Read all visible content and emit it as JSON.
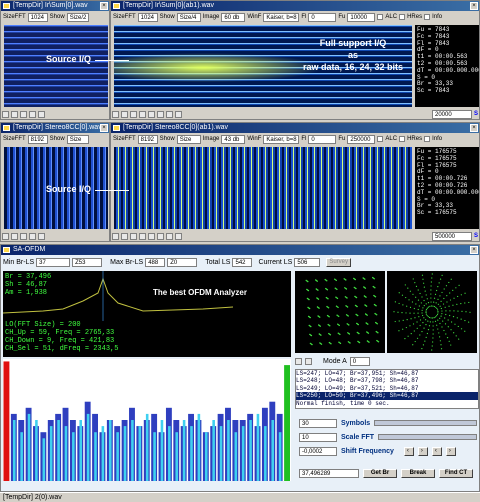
{
  "win1": {
    "title": "[TempDir] Ir\\Sum[0].wav",
    "size_label": "SizeFFT",
    "size_val": "1024",
    "show_label": "Show",
    "show_val": "Size/2"
  },
  "win2": {
    "title": "[TempDir] Ir\\Sum[0](ab1).wav",
    "size_label": "SizeFFT",
    "size_val": "1024",
    "show_label": "Show",
    "show_val": "Size/4",
    "image_label": "Image",
    "image_val": "60 db",
    "win_label": "WinF",
    "win_val": "Kaiser, b=8",
    "fl_label": "Fl",
    "fl_val": "0",
    "fu_label": "Fu",
    "fu_val": "10000",
    "alc": "ALC",
    "hres": "HRes",
    "info": "Info",
    "overlay": "Full support I/Q\nas\nraw data, 16, 24, 32 bits",
    "stats": [
      "Fu = 7843",
      "Fc = 7843",
      "Fl = 7843",
      "dF = 0",
      "t1 = 00:00.563",
      "t2 = 00:00.563",
      "dT = 00:00.000.000",
      "S = 0",
      "Br = 33,33",
      "Sc = 7843"
    ],
    "bottom_val": "20000",
    "bottom_S": "S"
  },
  "win3": {
    "title": "[TempDir] Stereo8CC[0].wav",
    "size_label": "SizeFFT",
    "size_val": "8192",
    "show_label": "Show",
    "show_val": "Size"
  },
  "win4": {
    "title": "[TempDir] Stereo8CC[0](ab1).wav",
    "size_label": "SizeFFT",
    "size_val": "8192",
    "show_label": "Show",
    "show_val": "Size",
    "image_label": "Image",
    "image_val": "43 db",
    "win_label": "WinF",
    "win_val": "Kaiser, b=8",
    "fl_label": "Fl",
    "fl_val": "0",
    "fu_label": "Fu",
    "fu_val": "250000",
    "alc": "ALC",
    "hres": "HRes",
    "info": "Info",
    "stats": [
      "Fu = 176575",
      "Fc = 176575",
      "Fl = 176575",
      "dF = 0",
      "t1 = 00:00.726",
      "t2 = 00:00.726",
      "dT = 00:00.000.000",
      "S = 0",
      "Br = 33,33",
      "Sc = 176575"
    ],
    "bottom_val": "500000",
    "bottom_S": "S"
  },
  "source_label": "Source I/Q",
  "ofdm": {
    "title": "SA-OFDM",
    "min_label": "Min Br-LS",
    "min_val": "37",
    "min_val2": "Z53",
    "max_label": "Max Br-LS",
    "max_val": "488",
    "max_val2": "Z0",
    "total_label": "Total LS",
    "total_val": "542",
    "current_label": "Current LS",
    "current_val": "506",
    "survey": "Survey",
    "graph_text": [
      "Br = 37,496",
      "Sh = 46,87",
      "Am = 1,938"
    ],
    "graph_title": "The best OFDM Analyzer",
    "info_lines": [
      "LO(FFT Size) = 200",
      "CH_Up = 59, Freq = 2765,33",
      "CH_Down = 9, Freq = 421,83",
      "CH_Sel = 51, dFreq = 2343,5"
    ],
    "mode_label": "Mode A",
    "mode_val": "0",
    "log": [
      "LS=247; LO=47; Br=37,951; Sh=46,87",
      "LS=248; LO=48; Br=37,798; Sh=46,87",
      "LS=249; LO=49; Br=37,521; Sh=46,87",
      "LS=250; LO=50; Br=37,496; Sh=46,87",
      "Normal finish, time 0 sec."
    ],
    "symbols_val": "30",
    "symbols_label": "Symbols",
    "scale_val": "10",
    "scale_label": "Scale FFT",
    "shift_val": "-0,0002",
    "shift_label": "Shift Frequency",
    "br_val": "37,496289",
    "getbr": "Get Br",
    "break": "Break",
    "findct": "Find CT",
    "bars": [
      0.98,
      0.55,
      0.5,
      0.6,
      0.45,
      0.4,
      0.5,
      0.55,
      0.6,
      0.5,
      0.45,
      0.65,
      0.55,
      0.4,
      0.5,
      0.45,
      0.5,
      0.6,
      0.45,
      0.5,
      0.55,
      0.4,
      0.6,
      0.5,
      0.45,
      0.55,
      0.5,
      0.4,
      0.45,
      0.55,
      0.6,
      0.5,
      0.5,
      0.55,
      0.45,
      0.6,
      0.65,
      0.55,
      0.95
    ],
    "bars2": [
      0.45,
      0.5,
      0.4,
      0.55,
      0.5,
      0.35,
      0.45,
      0.5,
      0.45,
      0.4,
      0.5,
      0.55,
      0.4,
      0.45,
      0.5,
      0.4,
      0.45,
      0.5,
      0.45,
      0.55,
      0.4,
      0.5,
      0.45,
      0.4,
      0.5,
      0.45,
      0.55,
      0.4,
      0.5,
      0.45,
      0.5,
      0.4,
      0.45,
      0.5,
      0.55,
      0.45,
      0.5,
      0.4,
      0.45
    ]
  },
  "statusbar": "[TempDir] 2(0).wav",
  "colors": {
    "bar_primary": "#2f3fbf",
    "bar_secondary": "#3fd0f0",
    "bar_first": "#e01010",
    "bar_last": "#20c020",
    "constellation": "#40e040"
  }
}
